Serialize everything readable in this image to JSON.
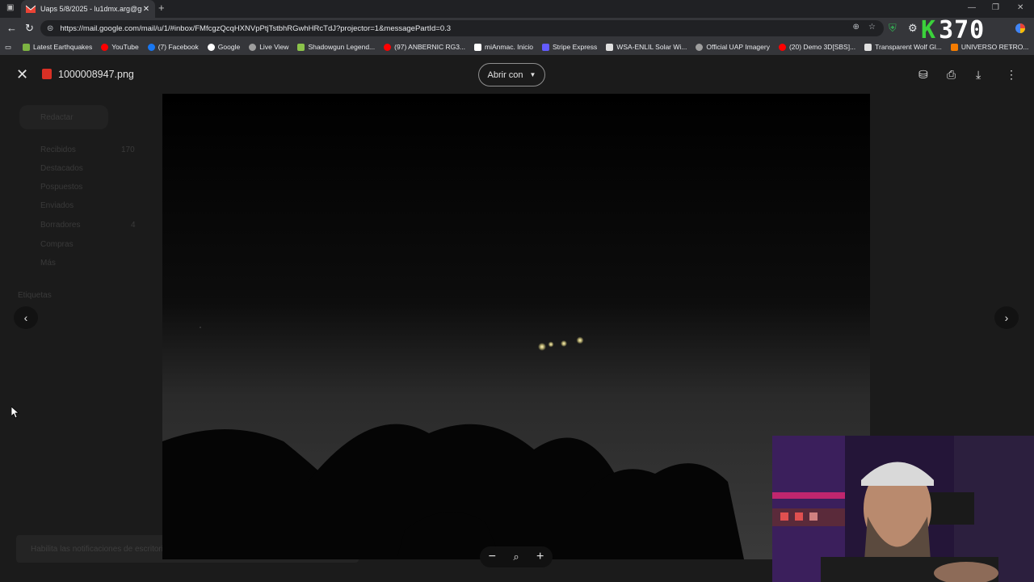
{
  "browser": {
    "tab": {
      "title": "Uaps 5/8/2025 - lu1dmx.arg@gm",
      "favicon": "gmail-icon"
    },
    "url": "https://mail.google.com/mail/u/1/#inbox/FMfcgzQcqHXNVpPtjTstbhRGwhHRcTdJ?projector=1&messagePartId=0.3",
    "bookmarks": [
      {
        "label": "Latest Earthquakes",
        "color": "#7cb342"
      },
      {
        "label": "YouTube",
        "color": "#ff0000"
      },
      {
        "label": "(7) Facebook",
        "color": "#1877f2"
      },
      {
        "label": "Google",
        "color": "#ffffff"
      },
      {
        "label": "Live View",
        "color": "#9e9e9e"
      },
      {
        "label": "Shadowgun Legend...",
        "color": "#8bc34a"
      },
      {
        "label": "(97) ANBERNIC RG3...",
        "color": "#ff0000"
      },
      {
        "label": "miAnmac. Inicio",
        "color": "#ffffff"
      },
      {
        "label": "Stripe Express",
        "color": "#635bff"
      },
      {
        "label": "WSA-ENLIL Solar Wi...",
        "color": "#e0e0e0"
      },
      {
        "label": "Official UAP Imagery",
        "color": "#9e9e9e"
      },
      {
        "label": "(20) Demo 3D[SBS]...",
        "color": "#ff0000"
      },
      {
        "label": "Transparent Wolf Gl...",
        "color": "#e0e0e0"
      },
      {
        "label": "UNIVERSO RETRO...",
        "color": "#f57c00"
      }
    ],
    "overlay_badge": {
      "letter": "K",
      "number": "370"
    }
  },
  "viewer": {
    "file_name": "1000008947.png",
    "open_with_label": "Abrir con",
    "icons": [
      "close-icon",
      "add-to-drive-icon",
      "print-icon",
      "download-icon",
      "more-vert-icon"
    ]
  },
  "gmail_background": {
    "compose": "Redactar",
    "nav": [
      {
        "label": "Recibidos",
        "count": "170"
      },
      {
        "label": "Destacados",
        "count": ""
      },
      {
        "label": "Pospuestos",
        "count": ""
      },
      {
        "label": "Enviados",
        "count": ""
      },
      {
        "label": "Borradores",
        "count": "4"
      },
      {
        "label": "Compras",
        "count": ""
      },
      {
        "label": "Más",
        "count": ""
      }
    ],
    "labels_heading": "Etiquetas",
    "toast": "Habilita las notificaciones de escritorio"
  }
}
